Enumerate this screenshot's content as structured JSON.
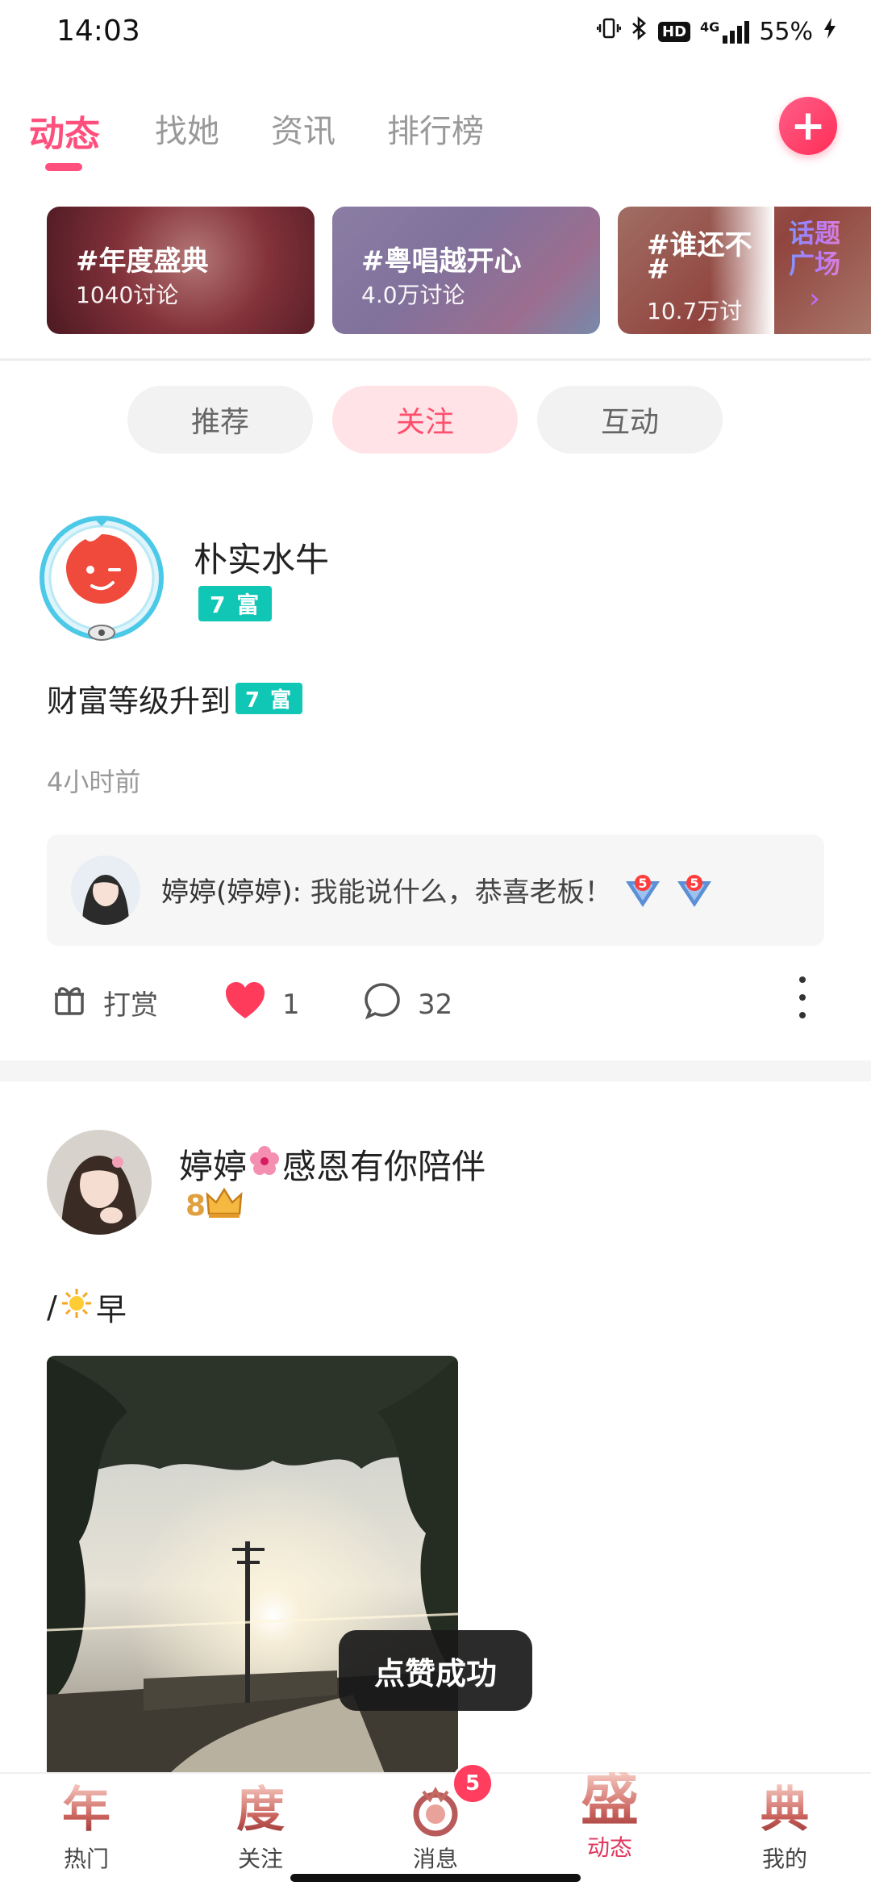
{
  "status_bar": {
    "time": "14:03",
    "network": "4G",
    "hd": "HD",
    "battery": "55%"
  },
  "top_tabs": {
    "items": [
      "动态",
      "找她",
      "资讯",
      "排行榜"
    ],
    "active": "动态",
    "add_label": "+"
  },
  "topics": [
    {
      "title": "#年度盛典",
      "sub": "1040讨论"
    },
    {
      "title": "#粤唱越开心",
      "sub": "4.0万讨论"
    },
    {
      "title": "#谁还不",
      "title2": "#",
      "sub": "10.7万讨"
    }
  ],
  "topic_plaza": {
    "line1": "话题",
    "line2": "广场",
    "chevron": "›"
  },
  "segments": {
    "items": [
      "推荐",
      "关注",
      "互动"
    ],
    "active": "关注"
  },
  "post1": {
    "username": "朴实水牛",
    "level_badge": "7 富",
    "text": "财富等级升到",
    "text_badge": "7 富",
    "time": "4小时前",
    "comment": {
      "author": "婷婷(婷婷):",
      "text": " 我能说什么，恭喜老板！",
      "badge_number": "5"
    },
    "actions": {
      "reward_label": "打赏",
      "like_count": "1",
      "comment_count": "32"
    }
  },
  "post2": {
    "username_part1": "婷婷",
    "username_part2": "感恩有你陪伴",
    "crown_level": "8",
    "text_prefix": "/",
    "text_suffix": "早"
  },
  "toast": "点赞成功",
  "bottom_nav": {
    "items": [
      {
        "glyph": "年",
        "label": "热门"
      },
      {
        "glyph": "度",
        "label": "关注"
      },
      {
        "glyph": "",
        "label": "消息"
      },
      {
        "glyph": "盛",
        "label": "动态"
      },
      {
        "glyph": "典",
        "label": "我的"
      }
    ],
    "active": "动态",
    "message_badge": "5"
  },
  "colors": {
    "accent": "#ff4f7d",
    "level_badge": "#10c6b5",
    "segment_active_bg": "#ffe3e6"
  }
}
